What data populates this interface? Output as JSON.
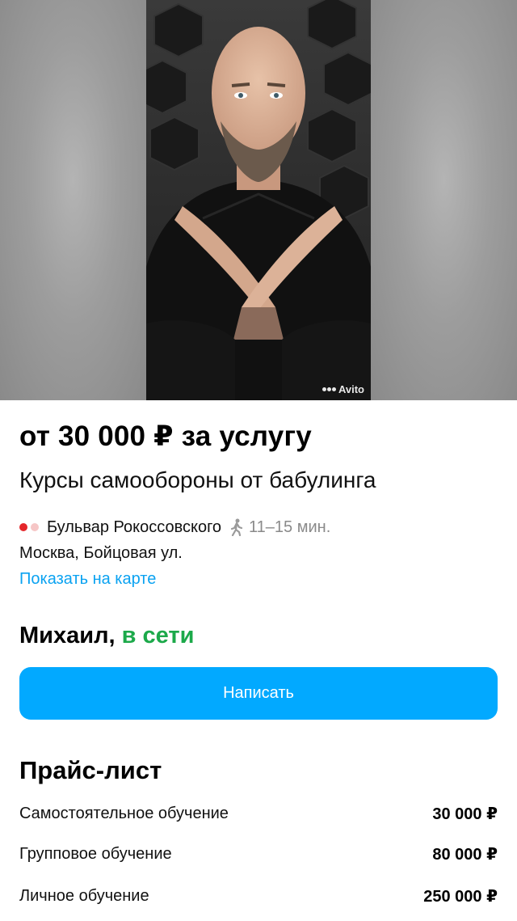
{
  "photo": {
    "watermark": "Avito",
    "alt_subject": "portrait"
  },
  "listing": {
    "price": "от 30 000 ₽ за услугу",
    "title": "Курсы самообороны от бабулинга",
    "metro_station": "Бульвар Рокоссовского",
    "metro_colors": [
      "#e4262a",
      "#f6c6c6"
    ],
    "walk_time": "11–15 мин.",
    "address": "Москва, Бойцовая ул.",
    "map_link": "Показать на карте"
  },
  "seller": {
    "name": "Михаил,",
    "status": "в сети",
    "status_color": "#1ca94a"
  },
  "actions": {
    "write_label": "Написать",
    "accent": "#02a9ff"
  },
  "price_list": {
    "title": "Прайс-лист",
    "items": [
      {
        "name": "Самостоятельное обучение",
        "price": "30 000 ₽"
      },
      {
        "name": "Групповое обучение",
        "price": "80 000 ₽"
      },
      {
        "name": "Личное обучение",
        "price": "250 000 ₽"
      }
    ]
  }
}
